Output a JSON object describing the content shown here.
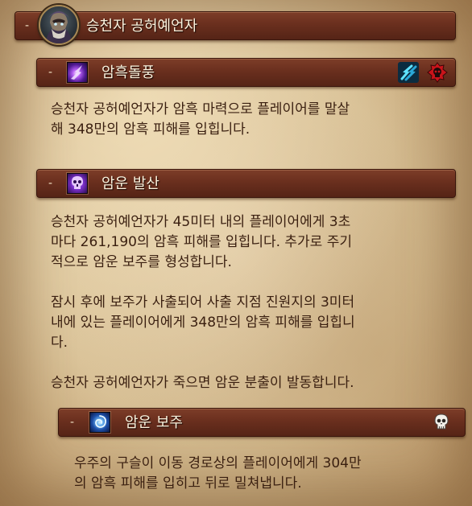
{
  "boss": {
    "toggle": "-",
    "name": "승천자 공허예언자"
  },
  "abilities": [
    {
      "toggle": "-",
      "name": "암흑돌풍",
      "icon": "shadow-burst-icon",
      "flags": [
        "interruptible-icon",
        "deadly-icon"
      ],
      "description": [
        "승천자 공허예언자가 암흑 마력으로 플레이어를 말살",
        "해 348만의 암흑 피해를 입힙니다."
      ]
    },
    {
      "toggle": "-",
      "name": "암운 발산",
      "icon": "dark-skull-icon",
      "flags": [],
      "description": [
        "승천자 공허예언자가 45미터 내의 플레이어에게 3초",
        "마다 261,190의 암흑 피해를 입힙니다. 추가로 주기",
        "적으로 암운 보주를 형성합니다.",
        "",
        "잠시 후에 보주가 사출되어 사출 지점 진원지의 3미터",
        "내에 있는 플레이어에게 348만의 암흑 피해를 입힙니",
        "다.",
        "",
        "승천자 공허예언자가 죽으면 암운 분출이 발동합니다."
      ]
    },
    {
      "toggle": "-",
      "name": "암운 보주",
      "icon": "void-orb-icon",
      "flags": [
        "add-skull-icon"
      ],
      "description": [
        "우주의 구슬이 이동 경로상의 플레이어에게 304만",
        "의 암흑 피해를 입히고 뒤로 밀쳐냅니다."
      ]
    }
  ],
  "colors": {
    "header_bar": "#6a2f1e",
    "header_text": "#fbf3de",
    "body_text": "#3a1f10",
    "parchment": "#dcc49a"
  }
}
